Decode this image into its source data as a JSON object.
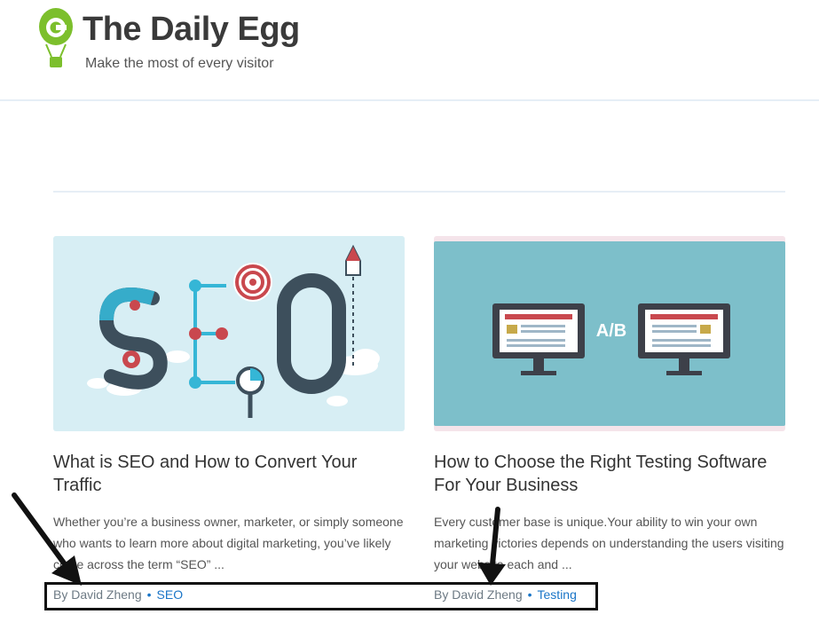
{
  "header": {
    "site_title": "The Daily Egg",
    "tagline": "Make the most of every visitor",
    "logo_color": "#7cbf2c"
  },
  "posts": [
    {
      "image": "seo-illustration",
      "title": "What is SEO and How to Convert Your Traffic",
      "excerpt": "Whether you’re a business owner, marketer, or simply someone who wants to learn more about digital marketing, you’ve likely come across the term “SEO” ...",
      "author": "By David Zheng",
      "category": "SEO"
    },
    {
      "image": "ab-testing-illustration",
      "image_text": "A/B",
      "title": "How to Choose the Right Testing Software For Your Business",
      "excerpt": "Every customer base is unique.Your ability to win your own marketing victories depends on understanding the users visiting your website each and ...",
      "author": "By David Zheng",
      "category": "Testing"
    }
  ],
  "colors": {
    "link": "#1a75c7",
    "annotation": "#111111"
  }
}
